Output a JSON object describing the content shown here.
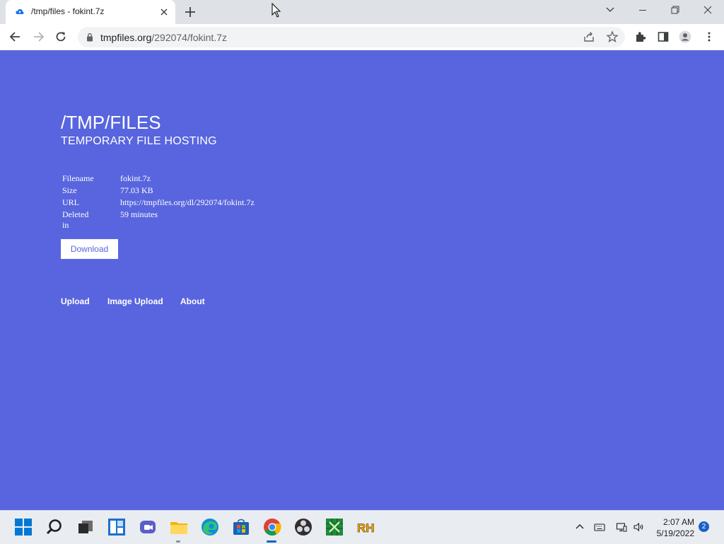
{
  "browser": {
    "tab_title": "/tmp/files - fokint.7z",
    "url_host": "tmpfiles.org",
    "url_path": "/292074/fokint.7z"
  },
  "page": {
    "title": "/TMP/FILES",
    "subtitle": "TEMPORARY FILE HOSTING",
    "info_rows": [
      {
        "label": "Filename",
        "value": "fokint.7z"
      },
      {
        "label": "Size",
        "value": "77.03 KB"
      },
      {
        "label": "URL",
        "value": "https://tmpfiles.org/dl/292074/fokint.7z"
      },
      {
        "label": "Deleted in",
        "value": "59 minutes"
      }
    ],
    "download_label": "Download",
    "footer_links": [
      "Upload",
      "Image Upload",
      "About"
    ],
    "background_color": "#5865de"
  },
  "taskbar": {
    "apps": [
      "windows-start-icon",
      "search-icon",
      "task-view-icon",
      "widgets-icon",
      "teams-chat-icon",
      "file-explorer-icon",
      "edge-icon",
      "store-icon",
      "chrome-icon",
      "obs-icon",
      "excel-like-icon",
      "rh-icon"
    ],
    "time": "2:07 AM",
    "date": "5/19/2022",
    "notification_count": "2"
  }
}
